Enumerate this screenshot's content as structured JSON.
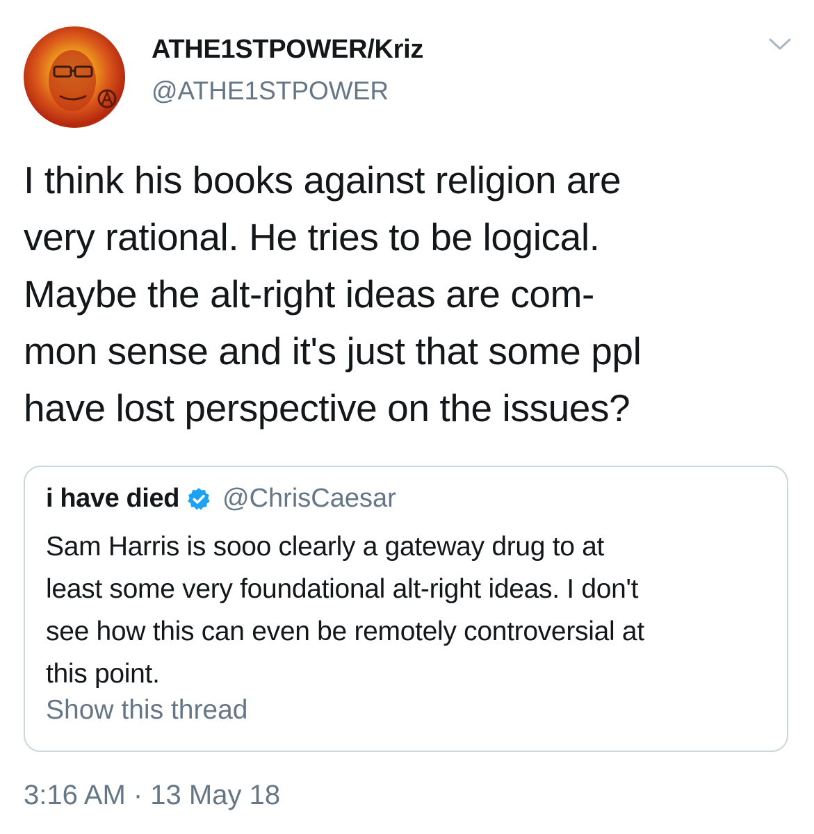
{
  "author": {
    "display_name": "ATHE1STPOWER/Kriz",
    "handle": "@ATHE1STPOWER",
    "avatar_icon": "profile-avatar"
  },
  "menu": {
    "icon": "chevron-down-icon"
  },
  "tweet": {
    "text": "I think his books against religion are\nvery rational. He tries to be logical.\nMaybe the alt-right ideas are com-\nmon sense and it's just that some ppl\nhave lost perspective on the issues?",
    "timestamp": "3:16 AM · 13 May 18"
  },
  "quoted_tweet": {
    "display_name": "i have died",
    "verified_icon": "verified-badge-icon",
    "handle": "@ChrisCaesar",
    "text": "Sam Harris is sooo clearly a gateway drug to at\nleast some very foundational alt-right ideas. I don't\nsee how this can even be remotely controversial at\nthis point.",
    "show_thread_label": "Show this thread"
  },
  "colors": {
    "text_primary": "#14171a",
    "text_secondary": "#657786",
    "border": "#ccd6dd",
    "verified_blue": "#1da1f2"
  }
}
